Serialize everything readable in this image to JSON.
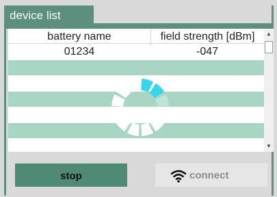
{
  "tab": {
    "title": "device list"
  },
  "table": {
    "columns": [
      "battery name",
      "field strength [dBm]"
    ],
    "rows": [
      {
        "battery_name": "01234",
        "field_strength": "-047"
      }
    ]
  },
  "buttons": {
    "stop_label": "stop",
    "connect_label": "connect"
  },
  "icons": {
    "wifi": "wifi-icon",
    "spinner": "loading-spinner-icon"
  },
  "colors": {
    "accent": "#5c8f7d",
    "row_stripe": "#a8d5c4",
    "spinner_active": "#33d6ef",
    "stop_button": "#4f8b74"
  }
}
